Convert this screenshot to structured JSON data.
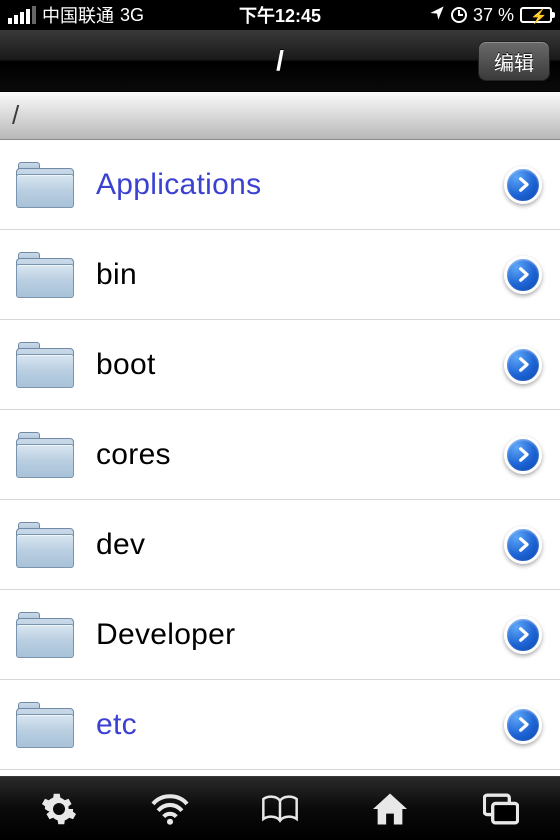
{
  "status": {
    "carrier": "中国联通",
    "network": "3G",
    "time": "下午12:45",
    "battery_pct": "37 %"
  },
  "nav": {
    "title": "/",
    "edit_label": "编辑"
  },
  "breadcrumb": "/",
  "rows": [
    {
      "name": "Applications",
      "link": true
    },
    {
      "name": "bin",
      "link": false
    },
    {
      "name": "boot",
      "link": false
    },
    {
      "name": "cores",
      "link": false
    },
    {
      "name": "dev",
      "link": false
    },
    {
      "name": "Developer",
      "link": false
    },
    {
      "name": "etc",
      "link": true
    }
  ]
}
